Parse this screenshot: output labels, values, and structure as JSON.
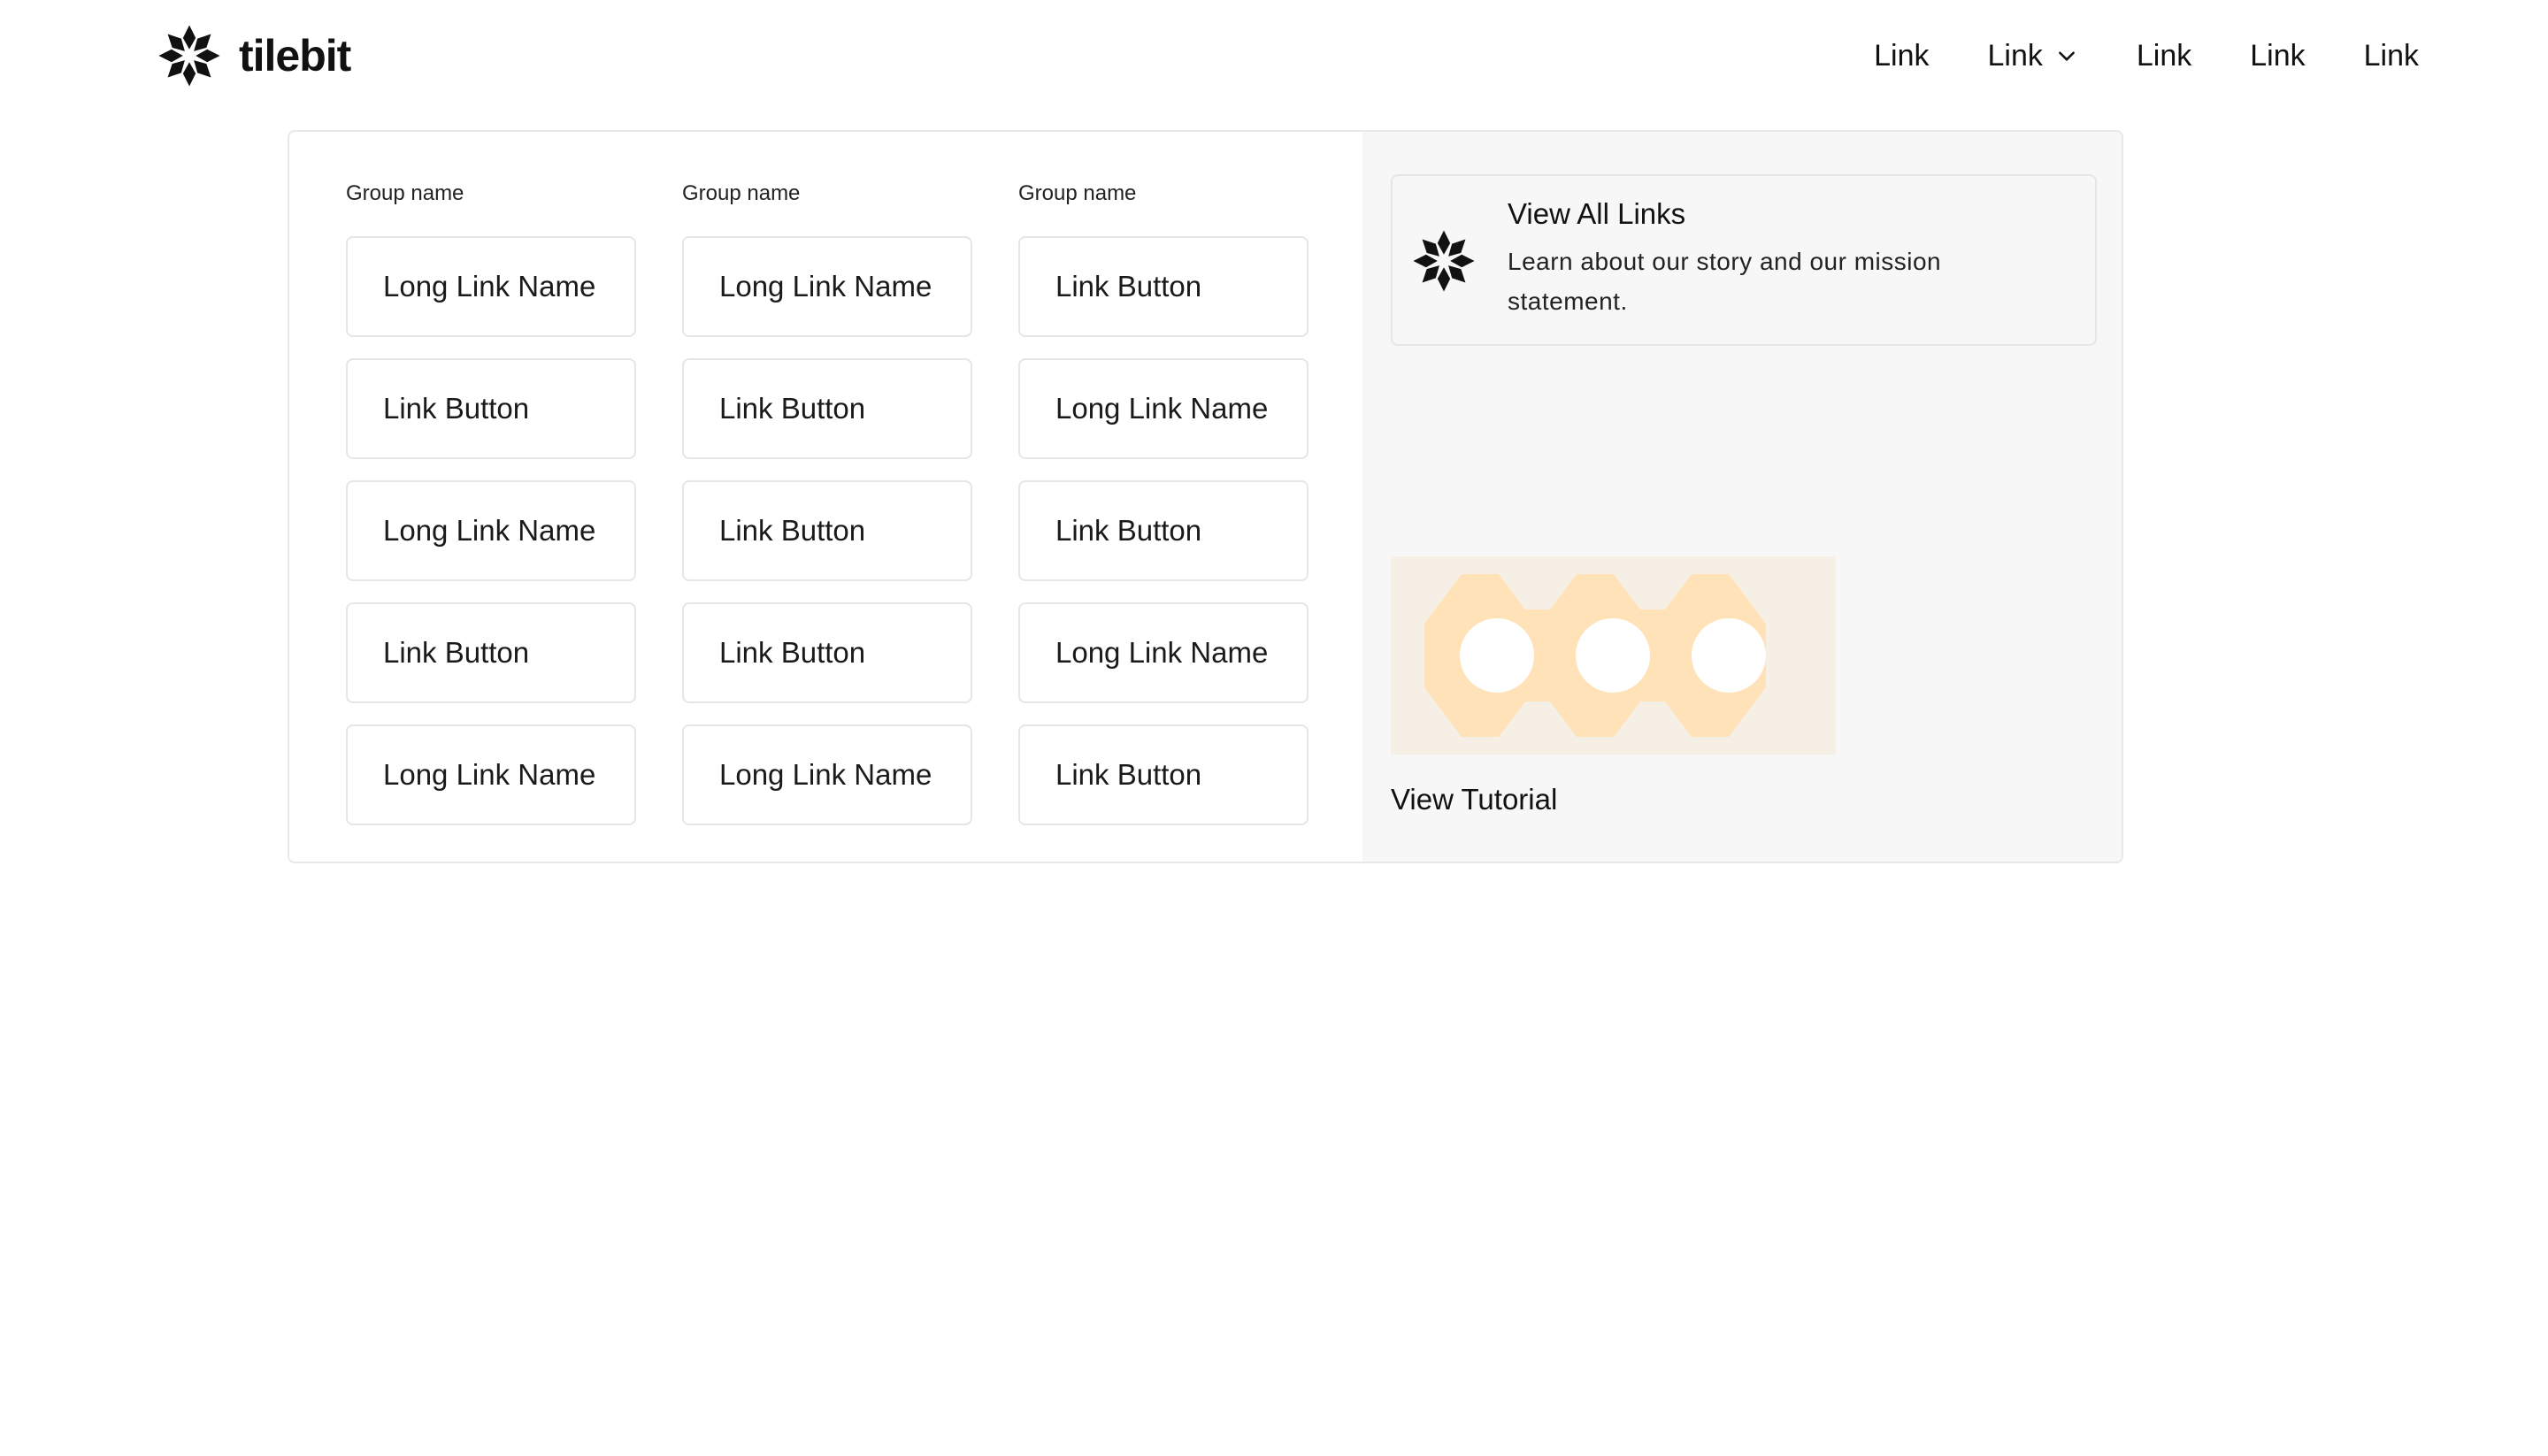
{
  "brand": {
    "name": "tilebit",
    "icon": "star-flower-icon"
  },
  "nav": {
    "links": [
      {
        "label": "Link",
        "has_dropdown": false
      },
      {
        "label": "Link",
        "has_dropdown": true
      },
      {
        "label": "Link",
        "has_dropdown": false
      },
      {
        "label": "Link",
        "has_dropdown": false
      },
      {
        "label": "Link",
        "has_dropdown": false
      }
    ]
  },
  "menu": {
    "groups": [
      {
        "title": "Group name",
        "items": [
          "Long Link Name",
          "Link Button",
          "Long Link Name",
          "Link Button",
          "Long Link Name"
        ]
      },
      {
        "title": "Group name",
        "items": [
          "Long Link Name",
          "Link Button",
          "Link Button",
          "Link Button",
          "Long Link Name"
        ]
      },
      {
        "title": "Group name",
        "items": [
          "Link Button",
          "Long Link Name",
          "Link Button",
          "Long Link Name",
          "Link Button"
        ]
      }
    ],
    "feature_card": {
      "title": "View All Links",
      "description": "Learn about our story and our mission statement.",
      "icon": "star-flower-icon"
    },
    "tutorial": {
      "label": "View Tutorial",
      "thumbnail": "hexagon-pattern-image"
    }
  },
  "colors": {
    "accent_light": "#ffe2b8",
    "panel_bg": "#f7f7f7",
    "border": "#e6e6e6"
  }
}
